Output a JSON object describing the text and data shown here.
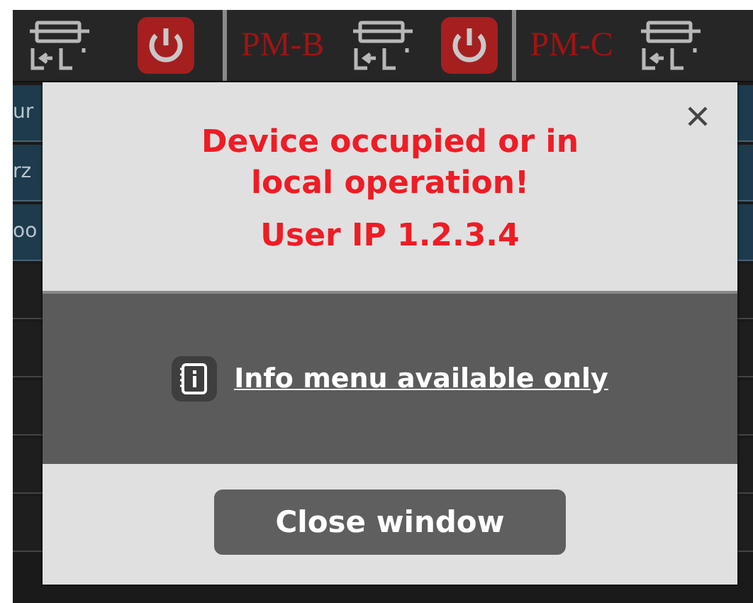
{
  "top_bar": {
    "module_labels": [
      "PM-B",
      "PM-C"
    ]
  },
  "side_rows": [
    "ur",
    "rz",
    "oo"
  ],
  "dialog": {
    "message": "Device occupied or in local operation!",
    "user_ip": "User IP 1.2.3.4",
    "info_link": "Info menu available only",
    "close_button": "Close window"
  }
}
